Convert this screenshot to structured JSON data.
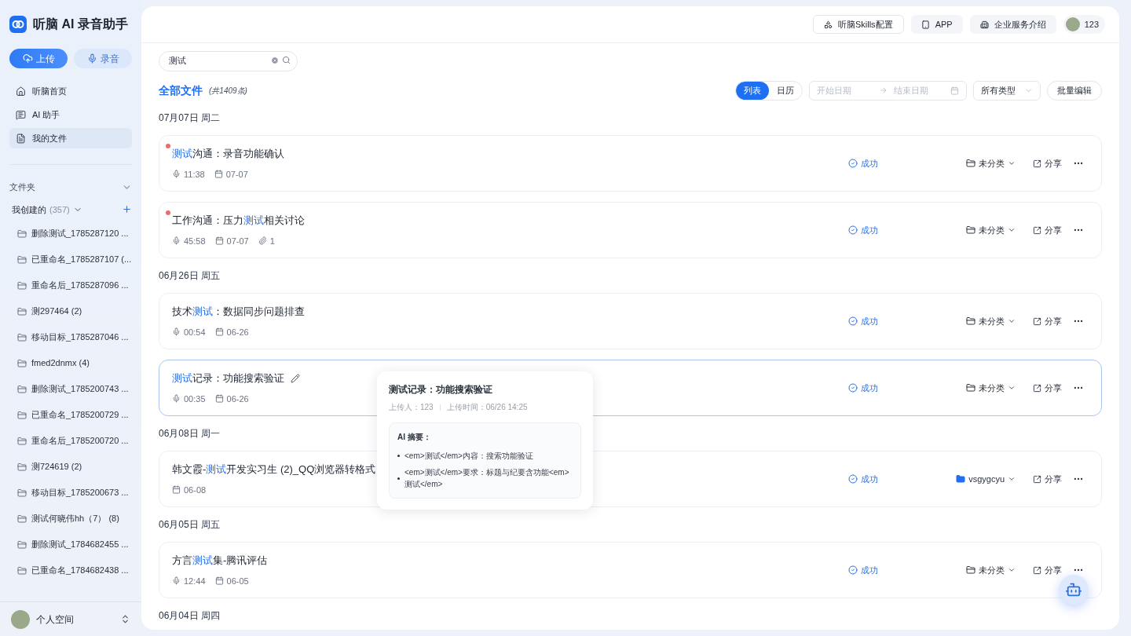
{
  "app": {
    "title": "听脑 AI 录音助手"
  },
  "actions": [
    {
      "label": "上传",
      "kind": "upload"
    },
    {
      "label": "录音",
      "kind": "record"
    }
  ],
  "nav": [
    {
      "label": "听脑首页",
      "kind": "home",
      "selected": false
    },
    {
      "label": "AI 助手",
      "kind": "assistant",
      "selected": false
    },
    {
      "label": "我的文件",
      "kind": "file",
      "selected": true
    }
  ],
  "folders": {
    "title": "文件夹",
    "expanded": true,
    "group": {
      "label": "我创建的",
      "count": "(357)",
      "expanded": true
    },
    "items": [
      "删除测试_1785287120 ...",
      "已重命名_1785287107 (...",
      "重命名后_1785287096 ...",
      "测297464 (2)",
      "移动目标_1785287046 ...",
      "fmed2dnmx (4)",
      "删除测试_1785200743 ...",
      "已重命名_1785200729 ...",
      "重命名后_1785200720 ...",
      "测724619 (2)",
      "移动目标_1785200673 ...",
      "测试何晓伟hh（7） (8)",
      "删除测试_1784682455 ...",
      "已重命名_1784682438 ..."
    ]
  },
  "account": {
    "label": "个人空间"
  },
  "header": {
    "buttons": [
      {
        "label": "听脑Skills配置",
        "kind": "skills"
      },
      {
        "label": "APP",
        "kind": "app"
      },
      {
        "label": "企业服务介绍",
        "kind": "enterprise"
      }
    ],
    "user": "123"
  },
  "search": {
    "value": "测试"
  },
  "heading": {
    "title": "全部文件",
    "count": "(共1409条)"
  },
  "view_tabs": [
    {
      "label": "列表",
      "selected": true
    },
    {
      "label": "日历",
      "selected": false
    }
  ],
  "date_range": {
    "start_placeholder": "开始日期",
    "end_placeholder": "结束日期"
  },
  "type_filter": {
    "value": "所有类型"
  },
  "batch_button": "批量编辑",
  "groups": [
    {
      "date": "07月07日 周二",
      "files": [
        {
          "title": [
            {
              "text": "测试",
              "highlight": true
            },
            {
              "text": "沟通：录音功能确认",
              "highlight": false
            }
          ],
          "unread": true,
          "hovered": false,
          "duration": "11:38",
          "date": "07-07",
          "status": "成功",
          "folder": {
            "label": "未分类",
            "kind": "none"
          },
          "share": "分享"
        },
        {
          "title": [
            {
              "text": "工作沟通：压力",
              "highlight": false
            },
            {
              "text": "测试",
              "highlight": true
            },
            {
              "text": "相关讨论",
              "highlight": false
            }
          ],
          "unread": true,
          "hovered": false,
          "duration": "45:58",
          "date": "07-07",
          "attachments": "1",
          "status": "成功",
          "folder": {
            "label": "未分类",
            "kind": "none"
          },
          "share": "分享"
        }
      ]
    },
    {
      "date": "06月26日 周五",
      "files": [
        {
          "title": [
            {
              "text": "技术",
              "highlight": false
            },
            {
              "text": "测试",
              "highlight": true
            },
            {
              "text": "：数据同步问题排查",
              "highlight": false
            }
          ],
          "unread": false,
          "hovered": false,
          "duration": "00:54",
          "date": "06-26",
          "status": "成功",
          "folder": {
            "label": "未分类",
            "kind": "none"
          },
          "share": "分享"
        },
        {
          "title": [
            {
              "text": "测试",
              "highlight": true
            },
            {
              "text": "记录：功能搜索验证",
              "highlight": false
            }
          ],
          "unread": false,
          "hovered": true,
          "duration": "00:35",
          "date": "06-26",
          "status": "成功",
          "folder": {
            "label": "未分类",
            "kind": "none"
          },
          "share": "分享"
        }
      ]
    },
    {
      "date": "06月08日 周一",
      "files": [
        {
          "title": [
            {
              "text": "韩文霞-",
              "highlight": false
            },
            {
              "text": "测试",
              "highlight": true
            },
            {
              "text": "开发实习生 (2)_QQ浏览器转格式",
              "highlight": false
            }
          ],
          "unread": false,
          "hovered": false,
          "date": "06-08",
          "status": "成功",
          "folder": {
            "label": "vsgygcyu",
            "kind": "folder"
          },
          "share": "分享"
        }
      ]
    },
    {
      "date": "06月05日 周五",
      "files": [
        {
          "title": [
            {
              "text": "方言",
              "highlight": false
            },
            {
              "text": "测试",
              "highlight": true
            },
            {
              "text": "集-腾讯评估",
              "highlight": false
            }
          ],
          "unread": false,
          "hovered": false,
          "duration": "12:44",
          "date": "06-05",
          "status": "成功",
          "folder": {
            "label": "未分类",
            "kind": "none"
          },
          "share": "分享"
        }
      ]
    },
    {
      "date": "06月04日 周四"
    }
  ],
  "popup": {
    "title": "测试记录：功能搜索验证",
    "uploader": "上传人：123",
    "upload_time": "上传时间：06/26 14:25",
    "summary_title": "AI 摘要：",
    "points": [
      "<em>测试</em>内容：搜索功能验证",
      "<em>测试</em>要求：标题与纪要含功能<em>测试</em>"
    ]
  }
}
